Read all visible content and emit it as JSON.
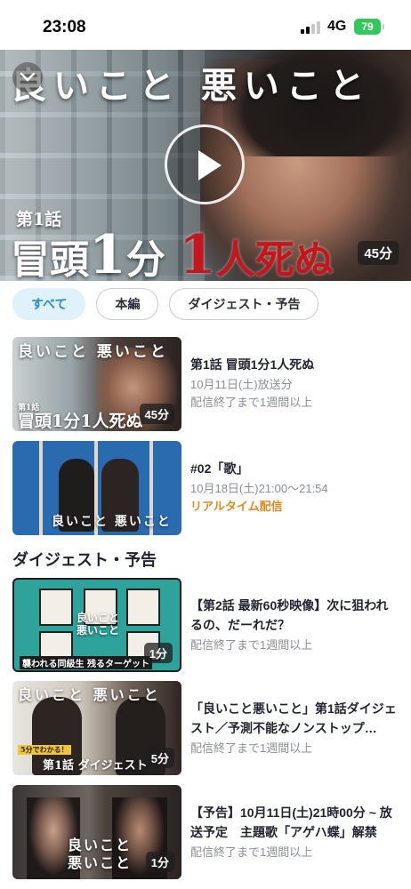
{
  "status_bar": {
    "time": "23:08",
    "network": "4G",
    "battery": "79"
  },
  "hero": {
    "show_title": "良いこと 悪いこと",
    "episode_label": "第1話",
    "caption_prefix": "冒頭",
    "caption_one": "1",
    "caption_unit": "分",
    "caption_one_red": "1",
    "caption_suffix": "人死ぬ",
    "duration": "45分"
  },
  "filters": [
    {
      "label": "すべて",
      "active": true
    },
    {
      "label": "本編",
      "active": false
    },
    {
      "label": "ダイジェスト・予告",
      "active": false
    }
  ],
  "episodes": [
    {
      "title": "第1話 冒頭1分1人死ぬ",
      "date": "10月11日(土)放送分",
      "availability": "配信終了まで1週間以上",
      "duration": "45分",
      "thumb_title": "良いこと 悪いこと",
      "thumb_caption": "冒頭1分1人死ぬ",
      "thumb_label": "第1話"
    },
    {
      "title": "#02「歌」",
      "date": "10月18日(土)21:00〜21:54",
      "status": "リアルタイム配信",
      "thumb_title": "良いこと 悪いこと"
    }
  ],
  "digest_section": {
    "title": "ダイジェスト・予告",
    "items": [
      {
        "title": "【第2話 最新60秒映像】次に狙われるの、だーれだ？",
        "availability": "配信終了まで1週間以上",
        "duration": "1分",
        "thumb_title": "良いこと 悪いこと",
        "thumb_caption": "襲われる同級生 残るターゲット"
      },
      {
        "title": "「良いこと悪いこと」第1話ダイジェスト／予測不能なノンストップ…",
        "availability": "配信終了まで1週間以上",
        "duration": "5分",
        "thumb_title": "良いこと 悪いこと",
        "thumb_caption": "第1話 ダイジェスト",
        "thumb_tag": "5分でわかる！"
      },
      {
        "title": "【予告】10月11日(土)21時00分 ~ 放送予定　主題歌「アゲハ蝶」解禁",
        "availability": "配信終了まで1週間以上",
        "duration": "1分",
        "thumb_title": "良いこと 悪いこと"
      }
    ]
  }
}
